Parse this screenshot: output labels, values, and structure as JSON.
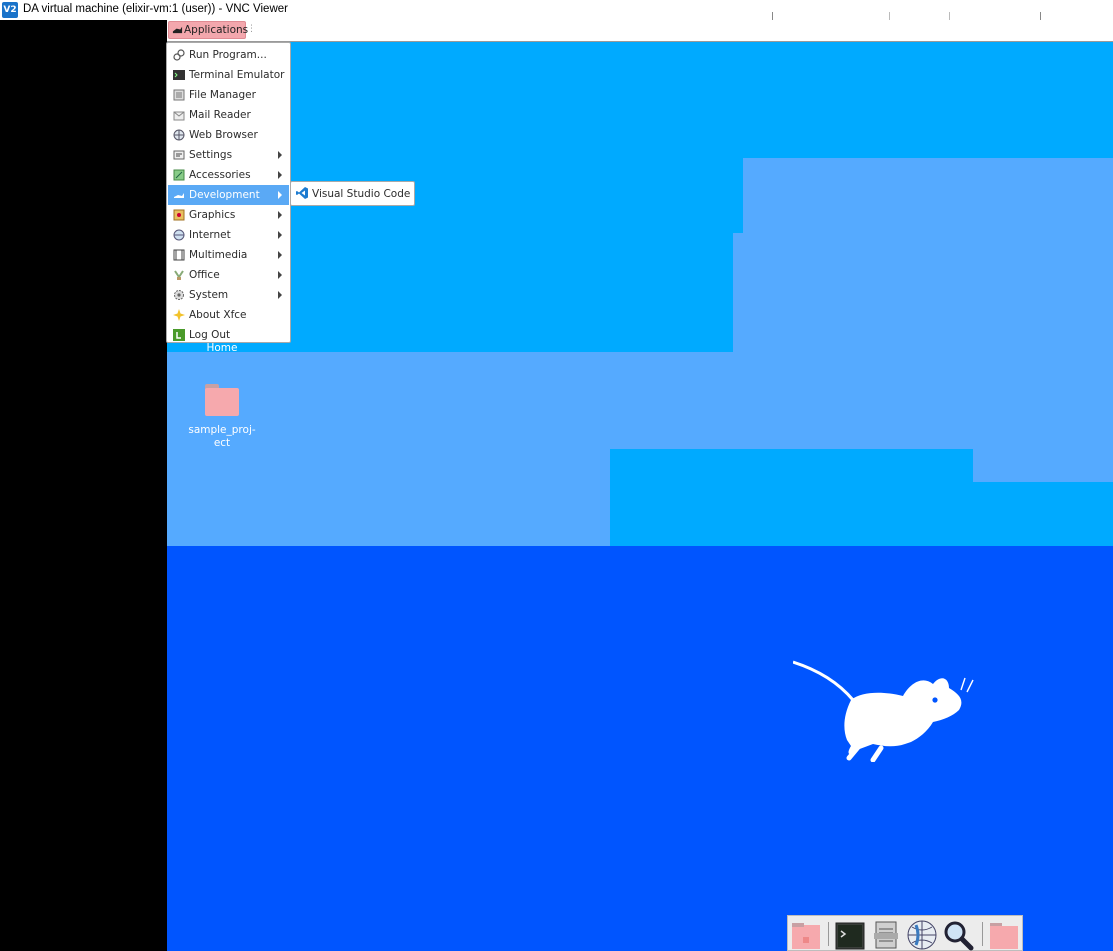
{
  "window": {
    "title": "DA virtual machine (elixir-vm:1 (user)) - VNC Viewer",
    "logo_text": "V2"
  },
  "panel": {
    "applications_label": "Applications",
    "handle": "⋮"
  },
  "menu": {
    "items": [
      {
        "label": "Run Program...",
        "icon": "run-icon",
        "submenu": false
      },
      {
        "label": "Terminal Emulator",
        "icon": "terminal-icon",
        "submenu": false
      },
      {
        "label": "File Manager",
        "icon": "file-manager-icon",
        "submenu": false
      },
      {
        "label": "Mail Reader",
        "icon": "mail-icon",
        "submenu": false
      },
      {
        "label": "Web Browser",
        "icon": "web-browser-icon",
        "submenu": false
      },
      {
        "label": "Settings",
        "icon": "settings-icon",
        "submenu": true
      },
      {
        "label": "Accessories",
        "icon": "accessories-icon",
        "submenu": true
      },
      {
        "label": "Development",
        "icon": "development-icon",
        "submenu": true
      },
      {
        "label": "Graphics",
        "icon": "graphics-icon",
        "submenu": true
      },
      {
        "label": "Internet",
        "icon": "internet-icon",
        "submenu": true
      },
      {
        "label": "Multimedia",
        "icon": "multimedia-icon",
        "submenu": true
      },
      {
        "label": "Office",
        "icon": "office-icon",
        "submenu": true
      },
      {
        "label": "System",
        "icon": "system-icon",
        "submenu": true
      },
      {
        "label": "About Xfce",
        "icon": "about-icon",
        "submenu": false
      },
      {
        "label": "Log Out",
        "icon": "logout-icon",
        "submenu": false
      }
    ],
    "active_item": "Development",
    "active_color": "#5aa9f5"
  },
  "submenu": {
    "items": [
      {
        "label": "Visual Studio Code",
        "icon": "vscode-icon"
      }
    ]
  },
  "desktop": {
    "icons": [
      {
        "label": "Home",
        "icon": "home-folder-icon"
      },
      {
        "label": "sample_proj-\nect",
        "icon": "folder-icon"
      }
    ],
    "colors": {
      "deep": "#0055ff",
      "mid": "#00aaff",
      "light": "#55aaff"
    }
  },
  "dock": {
    "items": [
      {
        "icon": "show-desktop-icon"
      },
      {
        "icon": "terminal-icon"
      },
      {
        "icon": "file-manager-icon"
      },
      {
        "icon": "web-browser-icon"
      },
      {
        "icon": "search-icon"
      },
      {
        "icon": "folder-icon"
      }
    ]
  }
}
